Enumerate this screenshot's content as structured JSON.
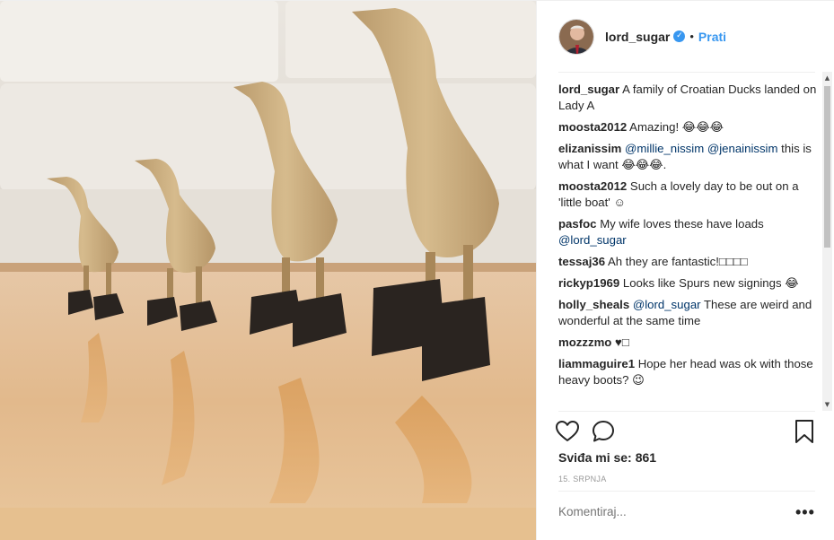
{
  "header": {
    "username": "lord_sugar",
    "verified_icon": "✓",
    "separator": "•",
    "follow_label": "Prati"
  },
  "comments": [
    {
      "user": "lord_sugar",
      "text": "A family of Croatian Ducks landed on Lady A"
    },
    {
      "user": "moosta2012",
      "text": "Amazing! 😂😂😂"
    },
    {
      "user": "elizanissim",
      "mention1": "@millie_nissim",
      "mention2": "@jenainissim",
      "text": "this is what I want 😂😂😂."
    },
    {
      "user": "moosta2012",
      "text": "Such a lovely day to be out on a 'little boat' ☺"
    },
    {
      "user": "pasfoc",
      "text": "My wife loves these have loads",
      "mention1": "@lord_sugar"
    },
    {
      "user": "tessaj36",
      "text": "Ah they are fantastic!□□□□"
    },
    {
      "user": "rickyp1969",
      "text": "Looks like Spurs new signings 😂"
    },
    {
      "user": "holly_sheals",
      "mention1": "@lord_sugar",
      "text": "These are weird and wonderful at the same time"
    },
    {
      "user": "mozzzmo",
      "text": "♥□"
    },
    {
      "user": "liammaguire1",
      "text": "Hope her head was ok with those heavy boots? 😉"
    }
  ],
  "footer": {
    "likes_label": "Sviđa mi se:",
    "likes_count": "861",
    "date": "15. SRPNJA",
    "comment_placeholder": "Komentiraj...",
    "more_label": "•••"
  },
  "icons": {
    "like": "heart-icon",
    "comment": "comment-bubble-icon",
    "save": "bookmark-icon"
  }
}
